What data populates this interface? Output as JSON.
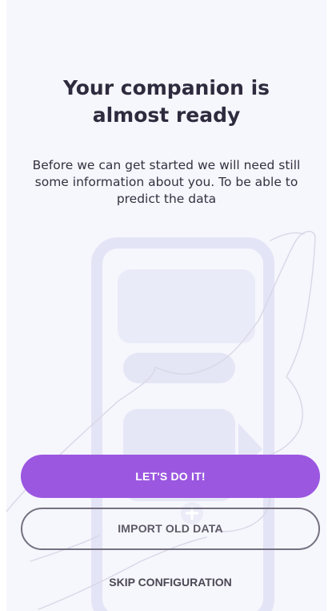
{
  "onboarding": {
    "title": "Your companion is almost ready",
    "description": "Before we can get started we will need still some information about you. To be able to predict the data"
  },
  "actions": {
    "primary_label": "LET'S DO IT!",
    "import_label": "IMPORT OLD DATA",
    "skip_label": "SKIP CONFIGURATION"
  },
  "colors": {
    "background": "#f6f6fd",
    "accent": "#9b57e0",
    "text": "#2e2b3e",
    "illustration": "#e4e5f6"
  },
  "illustration": {
    "name": "hand-holding-phone-illustration"
  }
}
